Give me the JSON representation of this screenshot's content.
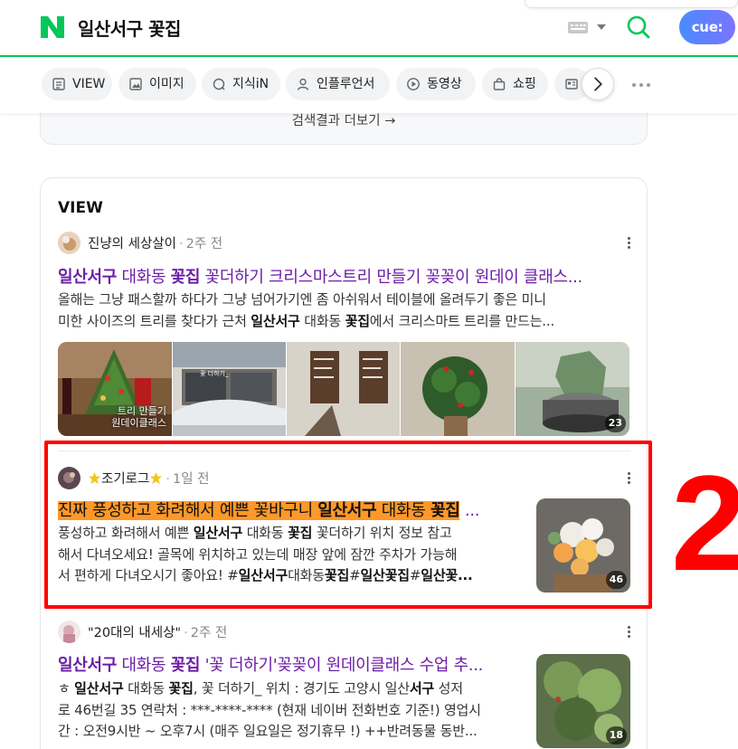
{
  "header": {
    "logo_letter": "N",
    "query": "일산서구 꽃집",
    "assistant_label": "cue:",
    "brand_color": "#03c75a"
  },
  "tabs": [
    {
      "label": "VIEW",
      "icon": "view-icon"
    },
    {
      "label": "이미지",
      "icon": "image-icon"
    },
    {
      "label": "지식iN",
      "icon": "knowledge-icon"
    },
    {
      "label": "인플루언서",
      "icon": "person-icon"
    },
    {
      "label": "동영상",
      "icon": "play-icon"
    },
    {
      "label": "쇼핑",
      "icon": "bag-icon"
    }
  ],
  "prev_section": {
    "more_results": "검색결과 더보기 →"
  },
  "view": {
    "title": "VIEW",
    "posts": [
      {
        "author": "진냥의 세상살이",
        "time": "2주 전",
        "title_parts": [
          {
            "text": "일산서구",
            "bold": true
          },
          {
            "text": " 대화동 ",
            "bold": false
          },
          {
            "text": "꽃집",
            "bold": true
          },
          {
            "text": " 꽃더하기 크리스마스트리 만들기 꽂꽂이 원데이 클래스...",
            "bold": false
          }
        ],
        "desc_line1": "올해는 그냥 패스할까 하다가 그냥 넘어가기엔 좀 아쉬워서 테이블에 올려두기 좋은 미니",
        "desc_line2_parts": [
          {
            "text": "미한 사이즈의 트리를 찾다가 근처 ",
            "bold": false
          },
          {
            "text": "일산서구",
            "bold": true
          },
          {
            "text": " 대화동 ",
            "bold": false
          },
          {
            "text": "꽃집",
            "bold": true
          },
          {
            "text": "에서 크리스마트 트리를 만드는...",
            "bold": false
          }
        ],
        "image_caption_line1": "트리 만들기",
        "image_caption_line2": "원데이클래스",
        "storefront_sign": "꽃 더하기_",
        "image_count": "23"
      },
      {
        "author": "조기로그",
        "time": "1일 전",
        "title_parts": [
          {
            "text": "진짜 풍성하고 화려해서 예쁜 꽃바구니 ",
            "bold": false,
            "highlight": true
          },
          {
            "text": "일산서구",
            "bold": true,
            "highlight": true
          },
          {
            "text": " 대화동 ",
            "bold": false,
            "highlight": true
          },
          {
            "text": "꽃집",
            "bold": true,
            "highlight": true
          },
          {
            "text": " ...",
            "bold": false,
            "highlight": false
          }
        ],
        "desc_line1_parts": [
          {
            "text": "풍성하고 화려해서 예쁜 ",
            "bold": false
          },
          {
            "text": "일산서구",
            "bold": true
          },
          {
            "text": " 대화동 ",
            "bold": false
          },
          {
            "text": "꽃집",
            "bold": true
          },
          {
            "text": " 꽃더하기 위치 정보 참고",
            "bold": false
          }
        ],
        "desc_line2": "해서 다녀오세요! 골목에 위치하고 있는데 매장 앞에 잠깐 주차가 가능해",
        "desc_line3_parts": [
          {
            "text": "서 편하게 다녀오시기 좋아요! #",
            "bold": false
          },
          {
            "text": "일산서구",
            "bold": true
          },
          {
            "text": "대화동",
            "bold": false
          },
          {
            "text": "꽃집",
            "bold": true
          },
          {
            "text": "#",
            "bold": false
          },
          {
            "text": "일산꽃집",
            "bold": true
          },
          {
            "text": "#",
            "bold": false
          },
          {
            "text": "일산꽃...",
            "bold": true
          }
        ],
        "image_count": "46"
      },
      {
        "author": "\"20대의 내세상\"",
        "time": "2주 전",
        "title_parts": [
          {
            "text": "일산서구",
            "bold": true
          },
          {
            "text": " 대화동 ",
            "bold": false
          },
          {
            "text": "꽃집",
            "bold": true
          },
          {
            "text": " '꽃 더하기'꽂꽂이 원데이클래스 수업 추...",
            "bold": false
          }
        ],
        "desc_line1_parts": [
          {
            "text": "ㅎ ",
            "bold": false
          },
          {
            "text": "일산서구",
            "bold": true
          },
          {
            "text": " 대화동 ",
            "bold": false
          },
          {
            "text": "꽃집",
            "bold": true
          },
          {
            "text": ", 꽃 더하기_ 위치 : 경기도 고양시 일산",
            "bold": false
          },
          {
            "text": "서구",
            "bold": true
          },
          {
            "text": " 성저",
            "bold": false
          }
        ],
        "desc_line2": "로 46번길 35 연락처 : ***-****-**** (현재 네이버 전화번호 기준!) 영업시",
        "desc_line3": "간 : 오전9시반 ~ 오후7시 (매주 일요일은 정기휴무 !) ++반려동물 동반...",
        "image_count": "18"
      }
    ]
  },
  "annotation": {
    "label": "2",
    "color": "#ff0000"
  }
}
